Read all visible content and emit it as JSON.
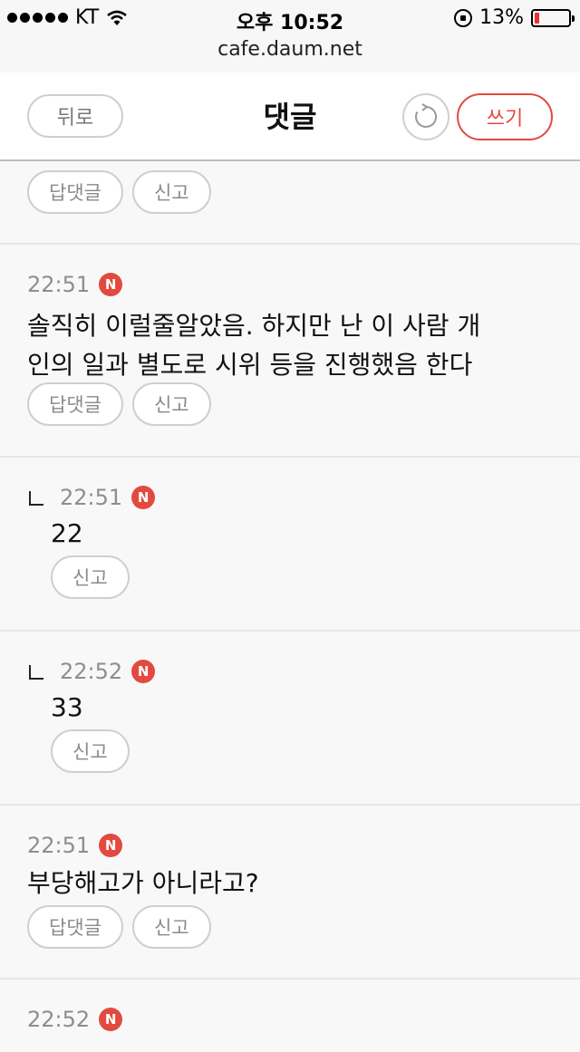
{
  "status_bar": {
    "carrier": "KT",
    "time": "오후 10:52",
    "battery": "13%",
    "battery_level": 0.13
  },
  "url": "cafe.daum.net",
  "header": {
    "back_label": "뒤로",
    "title": "댓글",
    "write_label": "쓰기"
  },
  "labels": {
    "reply": "답댓글",
    "report": "신고",
    "new_badge": "N"
  },
  "comments": [
    {
      "time": "22:51",
      "text_line1": "솔직히 이럴줄알았음. 하지만 난 이 사람 개",
      "text_line2": "인의 일과 별도로 시위 등을 진행했음 한다"
    },
    {
      "time": "22:51",
      "text": "22"
    },
    {
      "time": "22:52",
      "text": "33"
    },
    {
      "time": "22:51",
      "text": "부당해고가 아니라고?"
    },
    {
      "time": "22:52"
    }
  ],
  "colors": {
    "accent": "#e24a3f",
    "muted_text": "#8e8e8e",
    "border": "#cfcfcf",
    "background": "#f8f8f8"
  }
}
